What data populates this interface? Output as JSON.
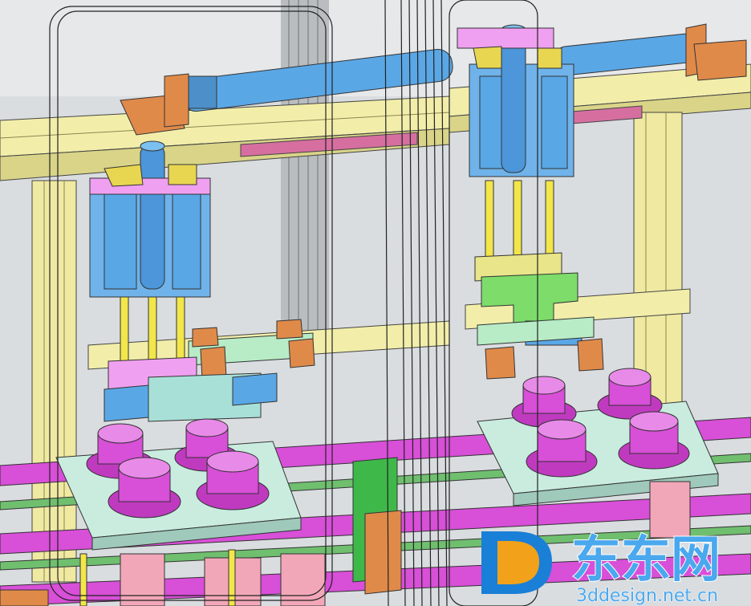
{
  "scene": {
    "kind": "3D CAD assembly render",
    "colors": {
      "background": "#d9dde0",
      "frame_yellow": "#f2eeaa",
      "cylinder_blue": "#5aa7e6",
      "magenta": "#d84fd8",
      "orange": "#e08a4a",
      "green": "#7ddc6a",
      "teal": "#a8e0d8",
      "pink": "#f0a0f0",
      "mint": "#b7ecc6",
      "rail_pink": "#d66fa0",
      "gray": "#a8acaf"
    }
  },
  "watermark": {
    "logo_letter": "D",
    "brand": "东东网",
    "url": "3ddesign.net.cn",
    "colors": {
      "logo_blue": "#1a7fd6",
      "logo_orange": "#f2a21a",
      "text": "#4aa8ee"
    }
  }
}
